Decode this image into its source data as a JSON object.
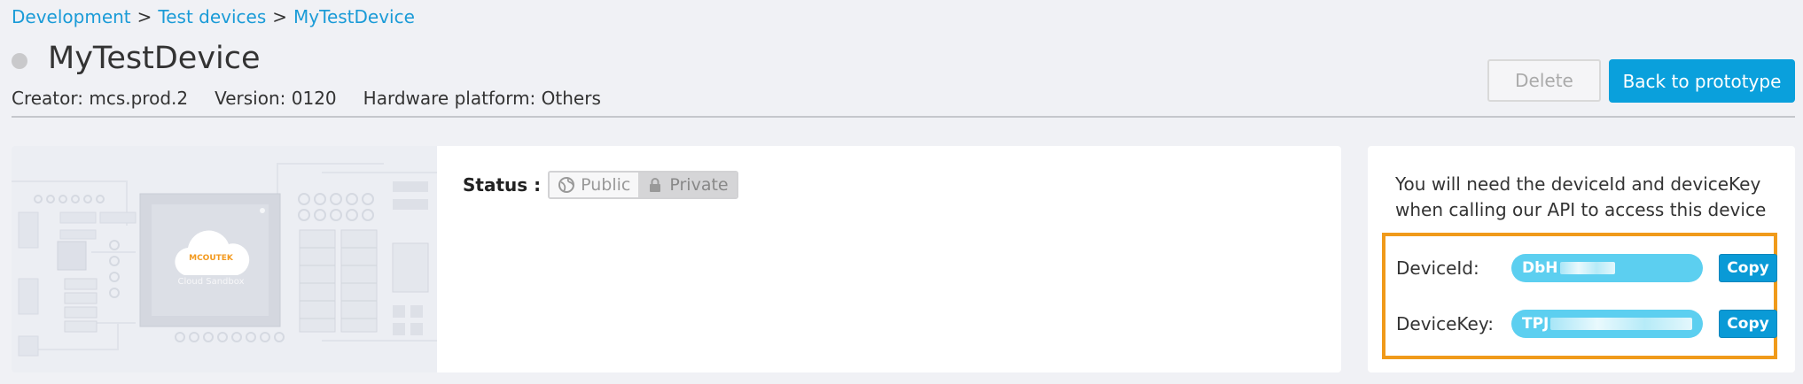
{
  "breadcrumb": {
    "items": [
      "Development",
      "Test devices",
      "MyTestDevice"
    ],
    "separator": ">"
  },
  "device": {
    "name": "MyTestDevice",
    "creator": "Creator: mcs.prod.2",
    "version": "Version: 0120",
    "platform": "Hardware platform: Others",
    "image_brand": "MCOUTEK",
    "image_caption": "Cloud Sandbox"
  },
  "actions": {
    "delete_label": "Delete",
    "back_label": "Back to prototype"
  },
  "status": {
    "label": "Status :",
    "options": [
      "Public",
      "Private"
    ],
    "selected": "Private"
  },
  "keys": {
    "hint": "You will need the deviceId and deviceKey when calling our API to access this device",
    "device_id_label": "DeviceId:",
    "device_id_prefix": "DbH",
    "device_key_label": "DeviceKey:",
    "device_key_prefix": "TPJ",
    "copy_label": "Copy"
  },
  "colors": {
    "accent": "#0aa0dc",
    "link": "#1a9bd7",
    "highlight_border": "#f09a1a",
    "key_pill": "#5ccff0"
  }
}
